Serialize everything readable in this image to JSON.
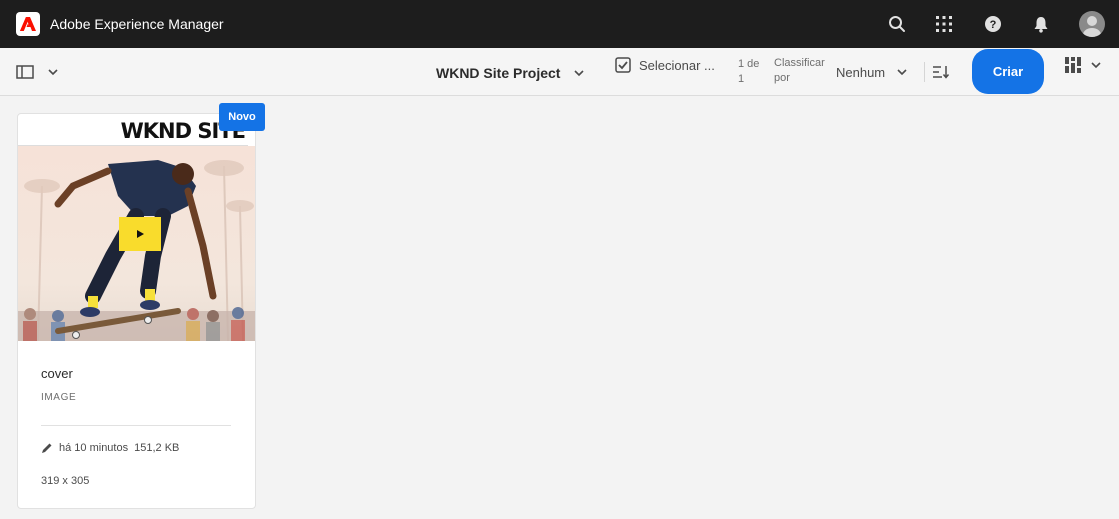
{
  "shell": {
    "title": "Adobe Experience Manager",
    "brand_color": "#fa0f00",
    "icons": [
      "search-icon",
      "app-grid-icon",
      "help-icon",
      "bell-icon",
      "user-avatar"
    ]
  },
  "toolbar": {
    "project_title": "WKND Site Project",
    "select_label": "Selecionar ...",
    "page_count": "1 de 1",
    "sort_label": "Classificar por",
    "sort_value": "Nenhum",
    "create_label": "Criar",
    "accent_color": "#1473e6"
  },
  "card": {
    "badge": "Novo",
    "thumb_brand": "WKND SITE",
    "title": "cover",
    "type": "IMAGE",
    "modified": "há 10 minutos",
    "size": "151,2 KB",
    "dimensions": "319 x 305",
    "play_color": "#f9dc2c"
  }
}
